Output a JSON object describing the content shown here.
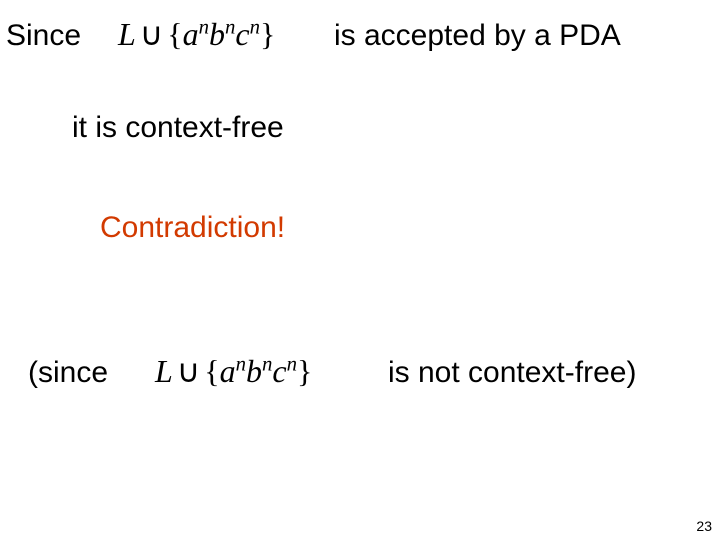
{
  "line1": {
    "since": "Since",
    "accepted": "is accepted by a PDA"
  },
  "math_expr": {
    "L": "L",
    "cup": "∪",
    "open": "{",
    "a": "a",
    "n1": "n",
    "b": "b",
    "n2": "n",
    "c": "c",
    "n3": "n",
    "close": "}"
  },
  "line2": "it is context-free",
  "line3": "Contradiction!",
  "line4": {
    "open_paren": "(since",
    "not_cf": "is not context-free)"
  },
  "page_number": "23"
}
